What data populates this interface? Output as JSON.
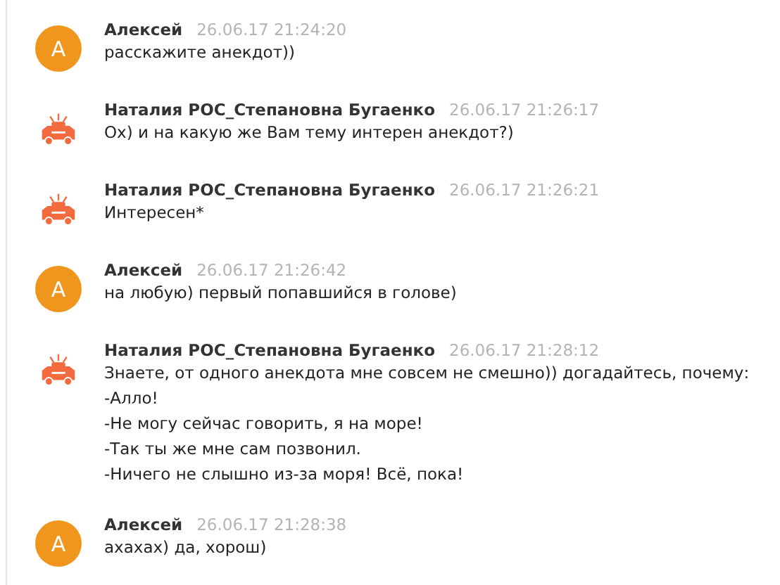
{
  "messages": [
    {
      "author": "Алексей",
      "time": "26.06.17 21:24:20",
      "avatar": {
        "kind": "letter",
        "letter": "А"
      },
      "lines": [
        "расскажите анекдот))"
      ]
    },
    {
      "author": "Наталия РОС_Степановна Бугаенко",
      "time": "26.06.17 21:26:17",
      "avatar": {
        "kind": "car"
      },
      "lines": [
        "Ох) и на какую же Вам тему интерен анекдот?)"
      ]
    },
    {
      "author": "Наталия РОС_Степановна Бугаенко",
      "time": "26.06.17 21:26:21",
      "avatar": {
        "kind": "car"
      },
      "lines": [
        "Интересен*"
      ]
    },
    {
      "author": "Алексей",
      "time": "26.06.17 21:26:42",
      "avatar": {
        "kind": "letter",
        "letter": "А"
      },
      "lines": [
        "на любую) первый попавшийся в голове)"
      ]
    },
    {
      "author": "Наталия РОС_Степановна Бугаенко",
      "time": "26.06.17 21:28:12",
      "avatar": {
        "kind": "car"
      },
      "lines": [
        "Знаете, от одного анекдота мне совсем не смешно)) догадайтесь, почему:",
        "-Алло!",
        "-Не могу сейчас говорить, я на море!",
        "-Так ты же мне сам позвонил.",
        "-Ничего не слышно из-за моря! Всё, пока!"
      ]
    },
    {
      "author": "Алексей",
      "time": "26.06.17 21:28:38",
      "avatar": {
        "kind": "letter",
        "letter": "А"
      },
      "lines": [
        "ахахах) да, хорош)"
      ]
    }
  ]
}
